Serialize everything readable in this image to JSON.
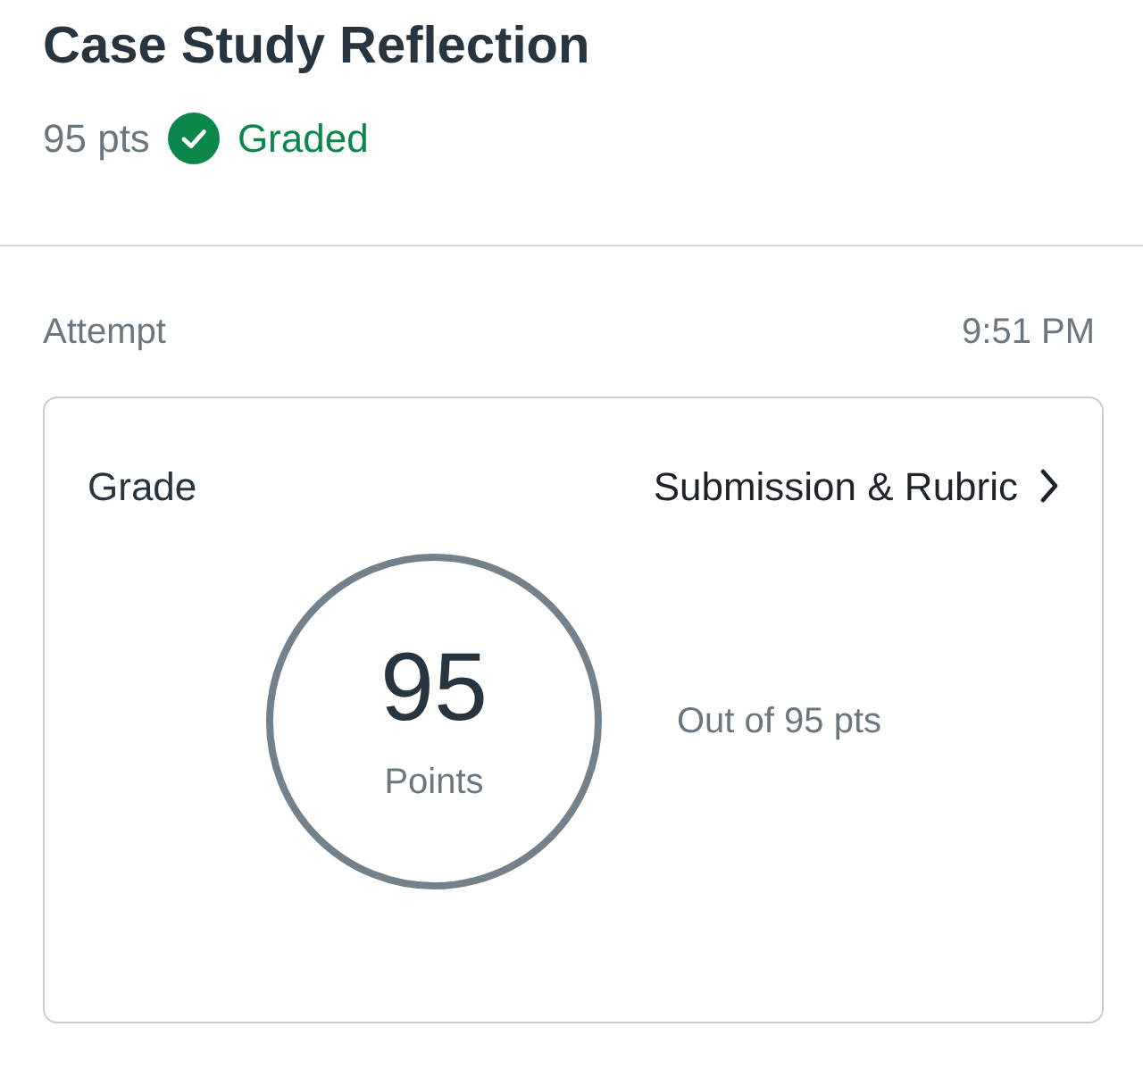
{
  "assignment": {
    "title": "Case Study Reflection",
    "points": "95 pts",
    "status": {
      "kind": "graded",
      "label": "Graded"
    }
  },
  "attempt": {
    "label": "Attempt",
    "time": "9:51 PM"
  },
  "grade_card": {
    "heading": "Grade",
    "link": "Submission & Rubric",
    "score": "95",
    "score_label": "Points",
    "out_of": "Out of 95 pts"
  }
}
